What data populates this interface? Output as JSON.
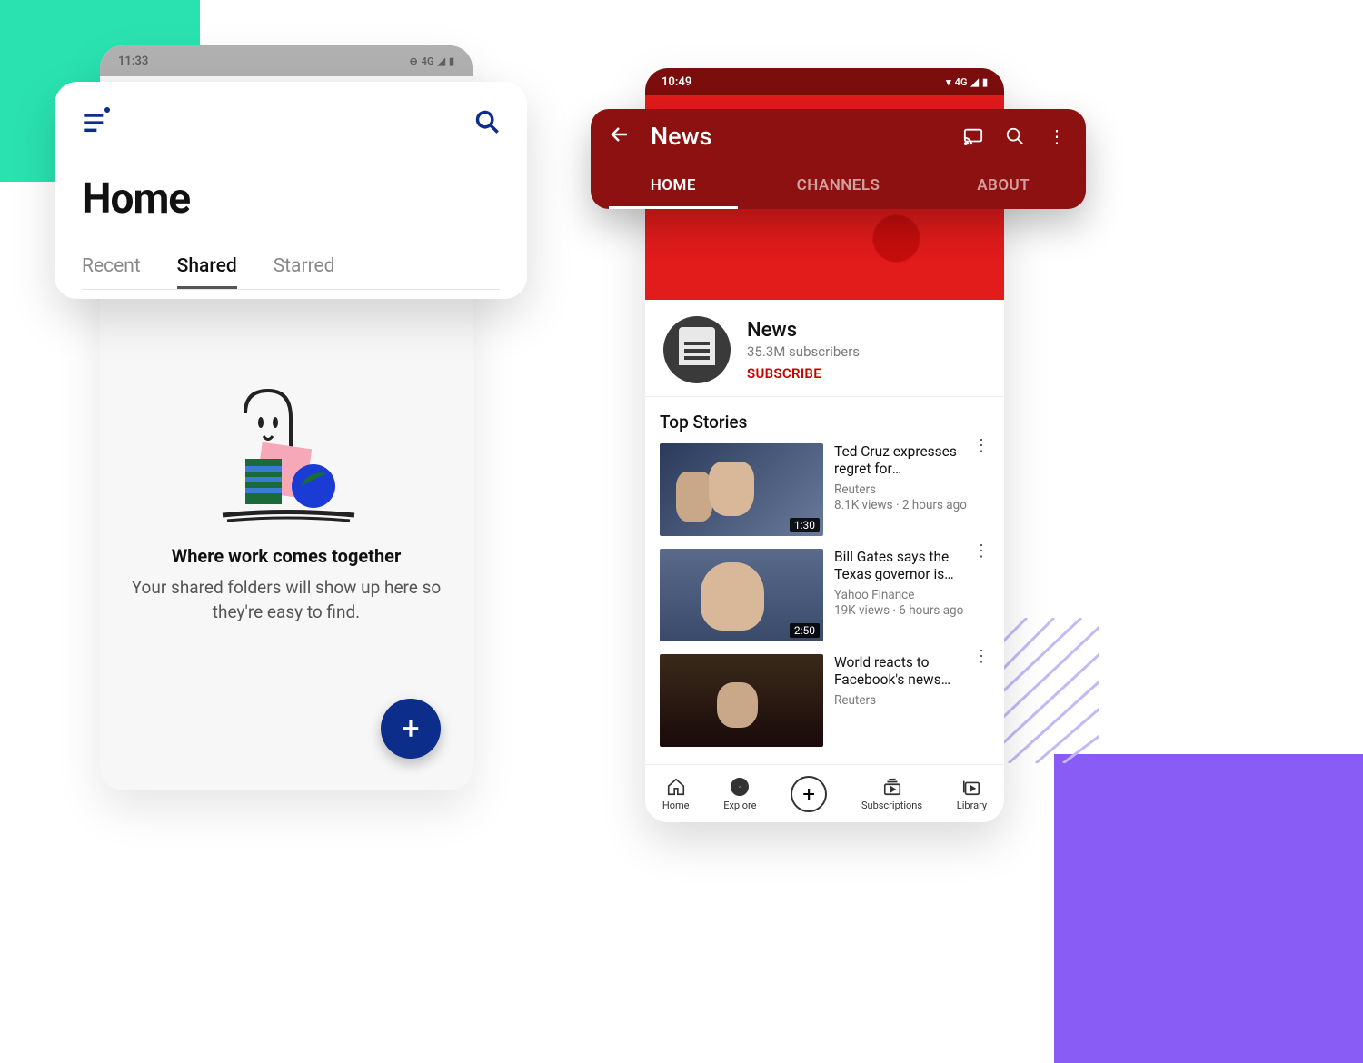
{
  "decor": {},
  "dropbox": {
    "status": {
      "time": "11:33",
      "net": "4G"
    },
    "title": "Home",
    "tabs": {
      "recent": "Recent",
      "shared": "Shared",
      "starred": "Starred"
    },
    "empty": {
      "heading": "Where work comes together",
      "sub": "Your shared folders will show up here so they're easy to find."
    },
    "fab": "+"
  },
  "youtube": {
    "status": {
      "time": "10:49",
      "net": "4G"
    },
    "appbar": {
      "title": "News"
    },
    "tabs": {
      "home": "HOME",
      "channels": "CHANNELS",
      "about": "ABOUT"
    },
    "channel": {
      "name": "News",
      "subs": "35.3M subscribers",
      "subscribe": "SUBSCRIBE"
    },
    "section_title": "Top Stories",
    "videos": [
      {
        "title": "Ted Cruz expresses regret for controversi…",
        "source": "Reuters",
        "stats": "8.1K views · 2 hours ago",
        "duration": "1:30"
      },
      {
        "title": "Bill Gates says the Texas governor is 'wr…",
        "source": "Yahoo Finance",
        "stats": "19K views · 6 hours ago",
        "duration": "2:50"
      },
      {
        "title": "World reacts to Facebook's news ban…",
        "source": "Reuters",
        "stats": "",
        "duration": ""
      }
    ],
    "bottom": {
      "home": "Home",
      "explore": "Explore",
      "subscriptions": "Subscriptions",
      "library": "Library"
    }
  }
}
